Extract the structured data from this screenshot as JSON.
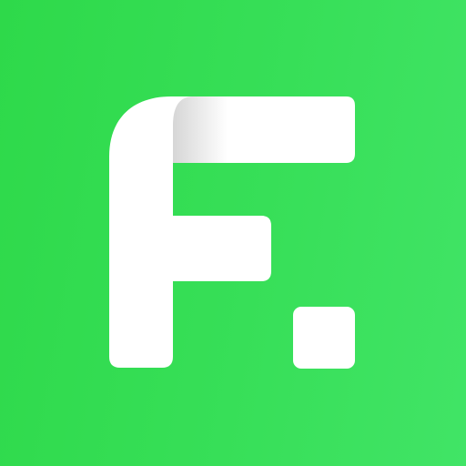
{
  "app_icon": {
    "name": "F logo",
    "icon": "letter-f-with-dot",
    "colors": {
      "background_start": "#2ed94a",
      "background_end": "#41e466",
      "glyph": "#ffffff",
      "fold_shadow": "#dedede"
    }
  }
}
